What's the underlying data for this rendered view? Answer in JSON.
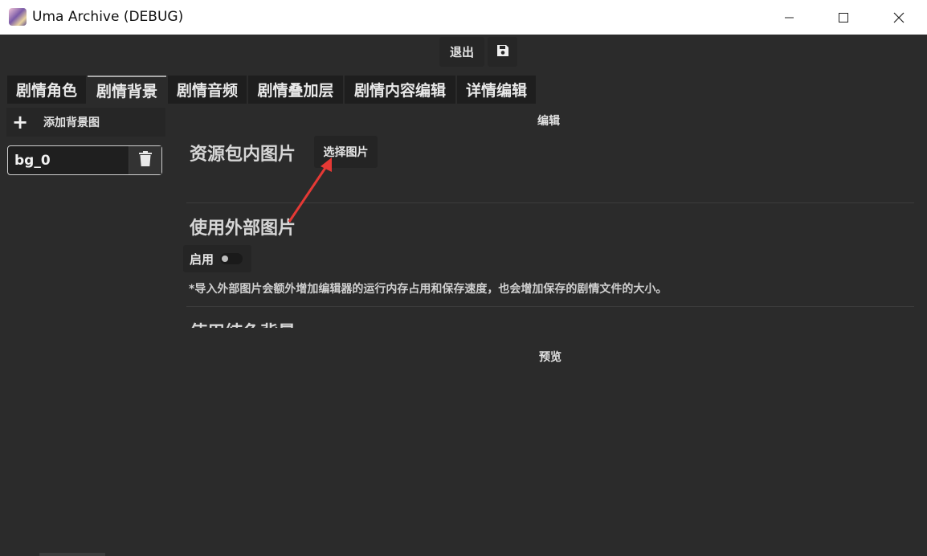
{
  "window": {
    "title": "Uma Archive (DEBUG)"
  },
  "toolbar": {
    "exit_label": "退出",
    "save_icon": "save-icon"
  },
  "tabs": [
    {
      "label": "剧情角色",
      "active": false
    },
    {
      "label": "剧情背景",
      "active": true
    },
    {
      "label": "剧情音频",
      "active": false
    },
    {
      "label": "剧情叠加层",
      "active": false
    },
    {
      "label": "剧情内容编辑",
      "active": false
    },
    {
      "label": "详情编辑",
      "active": false
    }
  ],
  "sidebar": {
    "add_label": "添加背景图",
    "items": [
      {
        "name": "bg_0"
      }
    ]
  },
  "editor": {
    "heading": "编辑",
    "pack_image_label": "资源包内图片",
    "select_image_label": "选择图片",
    "external_image_label": "使用外部图片",
    "enable_label": "启用",
    "enable_on": false,
    "note": "*导入外部图片会额外增加编辑器的运行内存占用和保存速度，也会增加保存的剧情文件的大小。",
    "solid_color_label": "使用纯色背景"
  },
  "preview": {
    "heading": "预览"
  },
  "colors": {
    "background": "#2b2b2b",
    "tab_bg": "#1e1e1e",
    "annotation_arrow": "#e53935"
  }
}
